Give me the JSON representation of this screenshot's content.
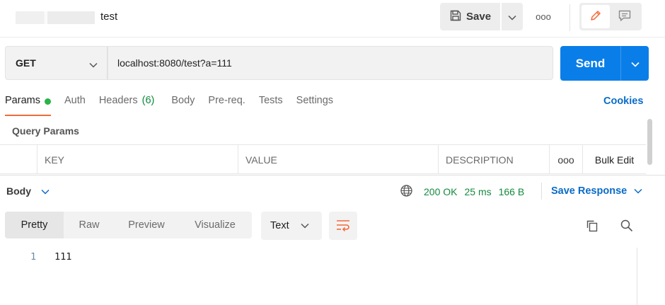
{
  "header": {
    "request_name": "test",
    "save_label": "Save",
    "more_icon": "ooo"
  },
  "request": {
    "method": "GET",
    "url": "localhost:8080/test?a=111",
    "send_label": "Send"
  },
  "tabs": [
    {
      "label": "Params",
      "active": true,
      "indicator": "green-dot"
    },
    {
      "label": "Auth"
    },
    {
      "label": "Headers",
      "count": "(6)"
    },
    {
      "label": "Body"
    },
    {
      "label": "Pre-req."
    },
    {
      "label": "Tests"
    },
    {
      "label": "Settings"
    }
  ],
  "cookies_label": "Cookies",
  "query_params": {
    "title": "Query Params",
    "columns": [
      "KEY",
      "VALUE",
      "DESCRIPTION"
    ],
    "more_icon": "ooo",
    "bulk_edit_label": "Bulk Edit"
  },
  "response": {
    "body_label": "Body",
    "status": "200 OK",
    "time": "25 ms",
    "size": "166 B",
    "save_response_label": "Save Response",
    "view_tabs": [
      "Pretty",
      "Raw",
      "Preview",
      "Visualize"
    ],
    "active_view": "Pretty",
    "language": "Text",
    "lines": [
      {
        "number": "1",
        "text": "111"
      }
    ]
  },
  "colors": {
    "accent_orange": "#f26b3a",
    "send_blue": "#0a7ee8",
    "link_blue": "#0a6bc7",
    "status_green": "#148a3e"
  }
}
